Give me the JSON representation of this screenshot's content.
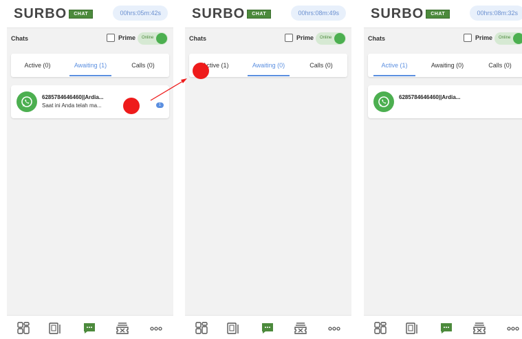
{
  "colors": {
    "accent_blue": "#5b8fe0",
    "brand_green": "#4c8a3c",
    "whatsapp_green": "#4caf50",
    "annotation_red": "#ee1b1b"
  },
  "panels": [
    {
      "logo": "SURBO",
      "logo_tag": "CHAT",
      "timer": "00hrs:05m:42s",
      "chats_title": "Chats",
      "prime_label": "Prime",
      "toggle_label": "Online",
      "tabs": [
        {
          "label": "Active (0)",
          "active": false
        },
        {
          "label": "Awaiting (1)",
          "active": true
        },
        {
          "label": "Calls (0)",
          "active": false
        }
      ],
      "chat": {
        "name": "6285784646460||Ardia...",
        "message": "Saat ini Anda telah ma...",
        "badge": "1"
      }
    },
    {
      "logo": "SURBO",
      "logo_tag": "CHAT",
      "timer": "00hrs:08m:49s",
      "chats_title": "Chats",
      "prime_label": "Prime",
      "toggle_label": "Online",
      "tabs": [
        {
          "label": "Active (1)",
          "active": false
        },
        {
          "label": "Awaiting (0)",
          "active": true
        },
        {
          "label": "Calls (0)",
          "active": false
        }
      ]
    },
    {
      "logo": "SURBO",
      "logo_tag": "CHAT",
      "timer": "00hrs:08m:32s",
      "chats_title": "Chats",
      "prime_label": "Prime",
      "toggle_label": "Online",
      "tabs": [
        {
          "label": "Active (1)",
          "active": true
        },
        {
          "label": "Awaiting (0)",
          "active": false
        },
        {
          "label": "Calls (0)",
          "active": false
        }
      ],
      "chat": {
        "name": "6285784646460||Ardia..."
      }
    }
  ],
  "bottom_nav": [
    "dashboard-icon",
    "documents-icon",
    "chat-icon",
    "tickets-icon",
    "more-icon"
  ]
}
